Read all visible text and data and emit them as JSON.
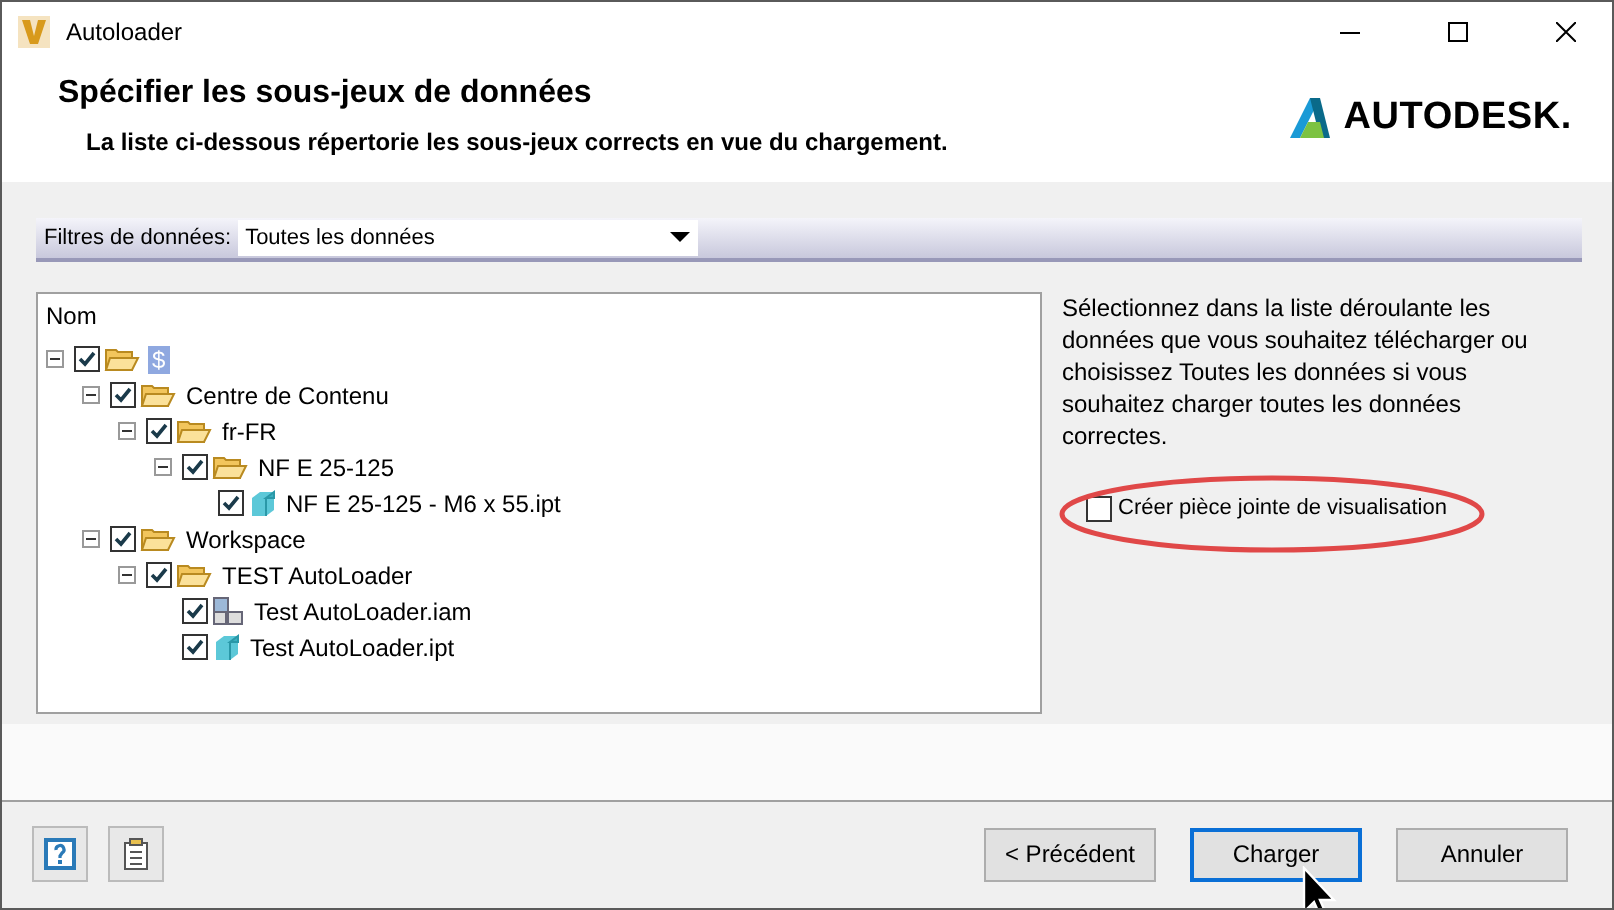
{
  "window": {
    "title": "Autoloader"
  },
  "header": {
    "title": "Spécifier les sous-jeux de données",
    "subtitle": "La liste ci-dessous répertorie les sous-jeux corrects en vue du chargement.",
    "logo": "AUTODESK."
  },
  "filter": {
    "label": "Filtres de données:",
    "value": "Toutes les données"
  },
  "tree": {
    "column": "Nom",
    "items": [
      {
        "label": "$",
        "kind": "vault",
        "checked": true,
        "expanded": true,
        "children": [
          {
            "label": "Centre de Contenu",
            "kind": "folder",
            "checked": true,
            "expanded": true,
            "children": [
              {
                "label": "fr-FR",
                "kind": "folder",
                "checked": true,
                "expanded": true,
                "children": [
                  {
                    "label": "NF E 25-125",
                    "kind": "folder",
                    "checked": true,
                    "expanded": true,
                    "children": [
                      {
                        "label": "NF E 25-125 - M6 x 55.ipt",
                        "kind": "part",
                        "checked": true
                      }
                    ]
                  }
                ]
              }
            ]
          },
          {
            "label": "Workspace",
            "kind": "folder",
            "checked": true,
            "expanded": true,
            "children": [
              {
                "label": "TEST AutoLoader",
                "kind": "folder",
                "checked": true,
                "expanded": true,
                "children": [
                  {
                    "label": "Test AutoLoader.iam",
                    "kind": "assembly",
                    "checked": true
                  },
                  {
                    "label": "Test AutoLoader.ipt",
                    "kind": "part",
                    "checked": true
                  }
                ]
              }
            ]
          }
        ]
      }
    ]
  },
  "info": {
    "text": "Sélectionnez dans la liste déroulante les données que vous souhaitez télécharger ou choisissez Toutes les données si vous souhaitez charger toutes les données correctes.",
    "option": {
      "label": "Créer pièce jointe de visualisation",
      "checked": false
    }
  },
  "buttons": [
    {
      "label": "< Précédent",
      "focused": false
    },
    {
      "label": "Charger",
      "focused": true
    },
    {
      "label": "Annuler",
      "focused": false
    }
  ]
}
